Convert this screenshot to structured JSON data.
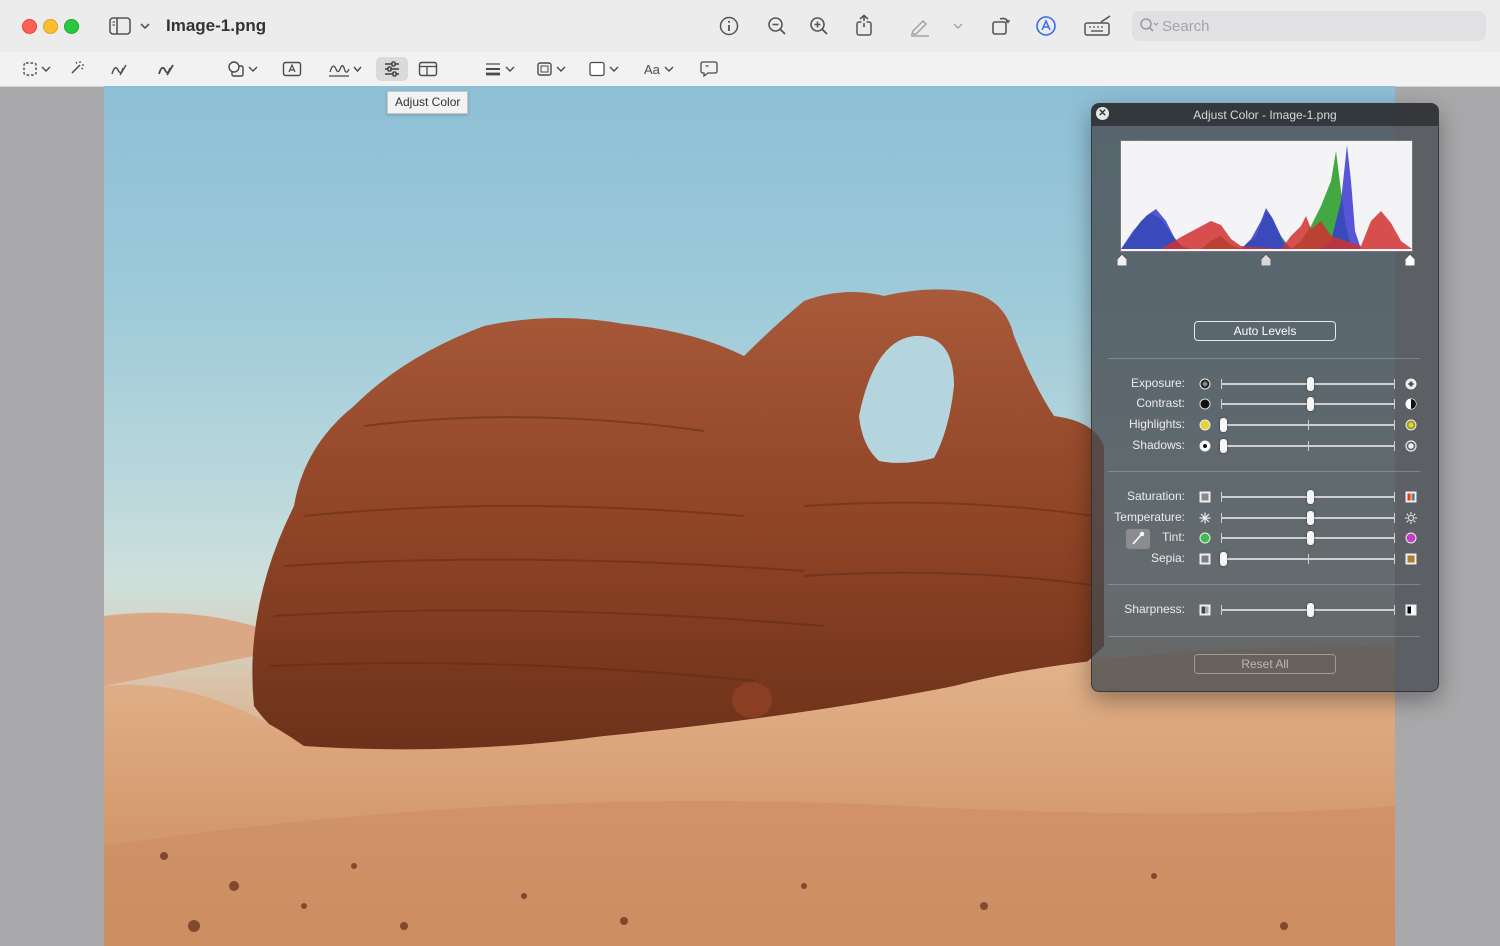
{
  "window": {
    "title": "Image-1.png"
  },
  "search": {
    "placeholder": "Search"
  },
  "tooltip": "Adjust Color",
  "panel": {
    "title": "Adjust Color - Image-1.png",
    "auto_levels": "Auto Levels",
    "reset_all": "Reset All",
    "adjustments": [
      {
        "label": "Exposure:",
        "value": 0.5,
        "left_icon": "exposure-low-icon",
        "right_icon": "exposure-high-icon"
      },
      {
        "label": "Contrast:",
        "value": 0.5,
        "left_icon": "contrast-low-icon",
        "right_icon": "contrast-high-icon"
      },
      {
        "label": "Highlights:",
        "value": 0.0,
        "left_icon": "highlights-low-icon",
        "right_icon": "highlights-high-icon"
      },
      {
        "label": "Shadows:",
        "value": 0.0,
        "left_icon": "shadows-low-icon",
        "right_icon": "shadows-high-icon"
      },
      {
        "label": "Saturation:",
        "value": 0.5,
        "left_icon": "saturation-low-icon",
        "right_icon": "saturation-high-icon"
      },
      {
        "label": "Temperature:",
        "value": 0.5,
        "left_icon": "temperature-cool-icon",
        "right_icon": "temperature-warm-icon"
      },
      {
        "label": "Tint:",
        "value": 0.5,
        "left_icon": "tint-green-icon",
        "right_icon": "tint-magenta-icon"
      },
      {
        "label": "Sepia:",
        "value": 0.0,
        "left_icon": "sepia-low-icon",
        "right_icon": "sepia-high-icon"
      },
      {
        "label": "Sharpness:",
        "value": 0.5,
        "left_icon": "sharpness-low-icon",
        "right_icon": "sharpness-high-icon"
      }
    ]
  },
  "colors": {
    "panel_bg": "#464a50",
    "accent": "#3a6bf0"
  }
}
